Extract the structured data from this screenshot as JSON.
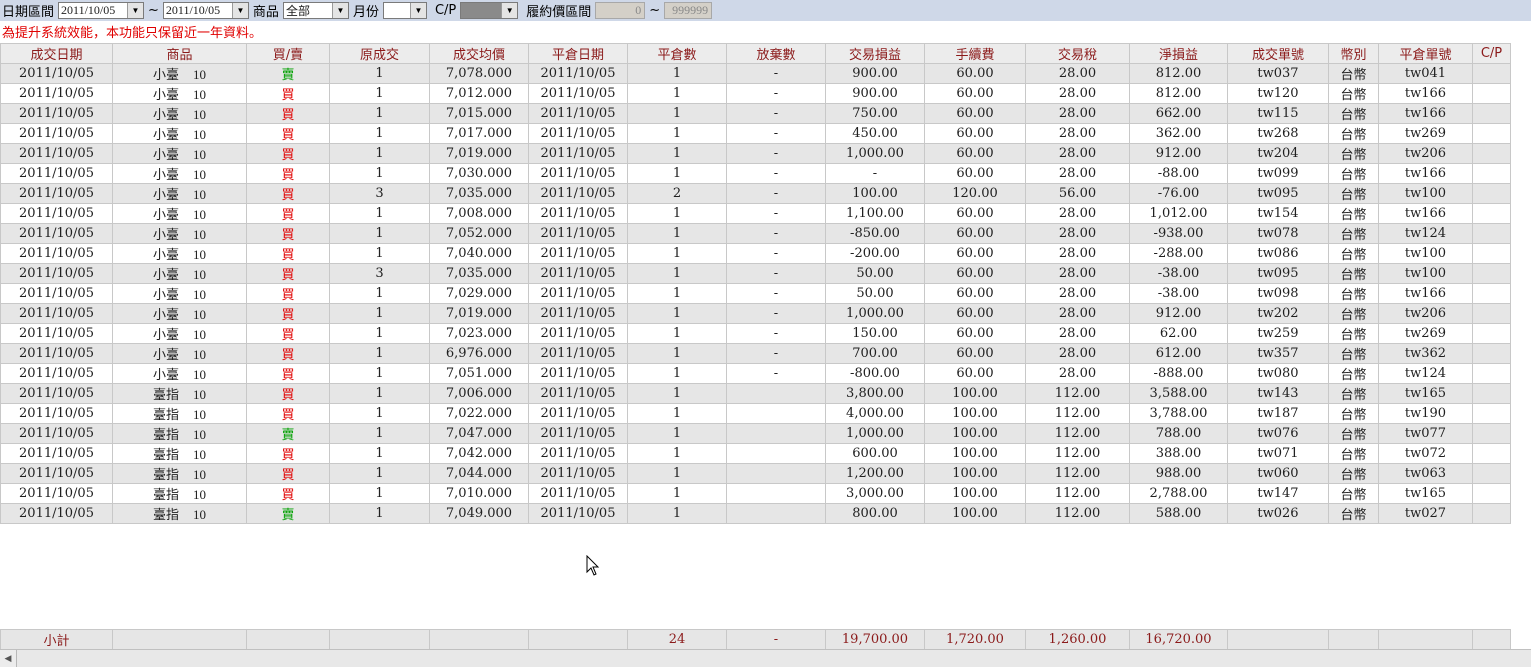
{
  "toolbar": {
    "date_range_label": "日期區間",
    "date_from": "2011/10/05",
    "date_sep": "~",
    "date_to": "2011/10/05",
    "product_label": "商品",
    "product_value": "全部",
    "month_label": "月份",
    "month_value": "",
    "cp_label": "C/P",
    "cp_value": "",
    "strike_label": "履約價區間",
    "strike_from": "0",
    "strike_sep": "~",
    "strike_to": "999999"
  },
  "notice": "為提升系統效能，本功能只保留近一年資料。",
  "columns": [
    "成交日期",
    "商品",
    "買/賣",
    "原成交",
    "成交均價",
    "平倉日期",
    "平倉數",
    "放棄數",
    "交易損益",
    "手續費",
    "交易稅",
    "淨損益",
    "成交單號",
    "幣別",
    "平倉單號",
    "C/P"
  ],
  "rows": [
    {
      "date": "2011/10/05",
      "product": "小臺",
      "code": "10",
      "side": "賣",
      "qty": "1",
      "avg": "7,078.000",
      "close_date": "2011/10/05",
      "close_qty": "1",
      "abandon": "-",
      "pl": "900.00",
      "fee": "60.00",
      "tax": "28.00",
      "net": "812.00",
      "order": "tw037",
      "cur": "台幣",
      "close_order": "tw041",
      "cp": ""
    },
    {
      "date": "2011/10/05",
      "product": "小臺",
      "code": "10",
      "side": "買",
      "qty": "1",
      "avg": "7,012.000",
      "close_date": "2011/10/05",
      "close_qty": "1",
      "abandon": "-",
      "pl": "900.00",
      "fee": "60.00",
      "tax": "28.00",
      "net": "812.00",
      "order": "tw120",
      "cur": "台幣",
      "close_order": "tw166",
      "cp": ""
    },
    {
      "date": "2011/10/05",
      "product": "小臺",
      "code": "10",
      "side": "買",
      "qty": "1",
      "avg": "7,015.000",
      "close_date": "2011/10/05",
      "close_qty": "1",
      "abandon": "-",
      "pl": "750.00",
      "fee": "60.00",
      "tax": "28.00",
      "net": "662.00",
      "order": "tw115",
      "cur": "台幣",
      "close_order": "tw166",
      "cp": ""
    },
    {
      "date": "2011/10/05",
      "product": "小臺",
      "code": "10",
      "side": "買",
      "qty": "1",
      "avg": "7,017.000",
      "close_date": "2011/10/05",
      "close_qty": "1",
      "abandon": "-",
      "pl": "450.00",
      "fee": "60.00",
      "tax": "28.00",
      "net": "362.00",
      "order": "tw268",
      "cur": "台幣",
      "close_order": "tw269",
      "cp": ""
    },
    {
      "date": "2011/10/05",
      "product": "小臺",
      "code": "10",
      "side": "買",
      "qty": "1",
      "avg": "7,019.000",
      "close_date": "2011/10/05",
      "close_qty": "1",
      "abandon": "-",
      "pl": "1,000.00",
      "fee": "60.00",
      "tax": "28.00",
      "net": "912.00",
      "order": "tw204",
      "cur": "台幣",
      "close_order": "tw206",
      "cp": ""
    },
    {
      "date": "2011/10/05",
      "product": "小臺",
      "code": "10",
      "side": "買",
      "qty": "1",
      "avg": "7,030.000",
      "close_date": "2011/10/05",
      "close_qty": "1",
      "abandon": "-",
      "pl": "-",
      "fee": "60.00",
      "tax": "28.00",
      "net": "-88.00",
      "order": "tw099",
      "cur": "台幣",
      "close_order": "tw166",
      "cp": ""
    },
    {
      "date": "2011/10/05",
      "product": "小臺",
      "code": "10",
      "side": "買",
      "qty": "3",
      "avg": "7,035.000",
      "close_date": "2011/10/05",
      "close_qty": "2",
      "abandon": "-",
      "pl": "100.00",
      "fee": "120.00",
      "tax": "56.00",
      "net": "-76.00",
      "order": "tw095",
      "cur": "台幣",
      "close_order": "tw100",
      "cp": ""
    },
    {
      "date": "2011/10/05",
      "product": "小臺",
      "code": "10",
      "side": "買",
      "qty": "1",
      "avg": "7,008.000",
      "close_date": "2011/10/05",
      "close_qty": "1",
      "abandon": "-",
      "pl": "1,100.00",
      "fee": "60.00",
      "tax": "28.00",
      "net": "1,012.00",
      "order": "tw154",
      "cur": "台幣",
      "close_order": "tw166",
      "cp": ""
    },
    {
      "date": "2011/10/05",
      "product": "小臺",
      "code": "10",
      "side": "買",
      "qty": "1",
      "avg": "7,052.000",
      "close_date": "2011/10/05",
      "close_qty": "1",
      "abandon": "-",
      "pl": "-850.00",
      "fee": "60.00",
      "tax": "28.00",
      "net": "-938.00",
      "order": "tw078",
      "cur": "台幣",
      "close_order": "tw124",
      "cp": ""
    },
    {
      "date": "2011/10/05",
      "product": "小臺",
      "code": "10",
      "side": "買",
      "qty": "1",
      "avg": "7,040.000",
      "close_date": "2011/10/05",
      "close_qty": "1",
      "abandon": "-",
      "pl": "-200.00",
      "fee": "60.00",
      "tax": "28.00",
      "net": "-288.00",
      "order": "tw086",
      "cur": "台幣",
      "close_order": "tw100",
      "cp": ""
    },
    {
      "date": "2011/10/05",
      "product": "小臺",
      "code": "10",
      "side": "買",
      "qty": "3",
      "avg": "7,035.000",
      "close_date": "2011/10/05",
      "close_qty": "1",
      "abandon": "-",
      "pl": "50.00",
      "fee": "60.00",
      "tax": "28.00",
      "net": "-38.00",
      "order": "tw095",
      "cur": "台幣",
      "close_order": "tw100",
      "cp": ""
    },
    {
      "date": "2011/10/05",
      "product": "小臺",
      "code": "10",
      "side": "買",
      "qty": "1",
      "avg": "7,029.000",
      "close_date": "2011/10/05",
      "close_qty": "1",
      "abandon": "-",
      "pl": "50.00",
      "fee": "60.00",
      "tax": "28.00",
      "net": "-38.00",
      "order": "tw098",
      "cur": "台幣",
      "close_order": "tw166",
      "cp": ""
    },
    {
      "date": "2011/10/05",
      "product": "小臺",
      "code": "10",
      "side": "買",
      "qty": "1",
      "avg": "7,019.000",
      "close_date": "2011/10/05",
      "close_qty": "1",
      "abandon": "-",
      "pl": "1,000.00",
      "fee": "60.00",
      "tax": "28.00",
      "net": "912.00",
      "order": "tw202",
      "cur": "台幣",
      "close_order": "tw206",
      "cp": ""
    },
    {
      "date": "2011/10/05",
      "product": "小臺",
      "code": "10",
      "side": "買",
      "qty": "1",
      "avg": "7,023.000",
      "close_date": "2011/10/05",
      "close_qty": "1",
      "abandon": "-",
      "pl": "150.00",
      "fee": "60.00",
      "tax": "28.00",
      "net": "62.00",
      "order": "tw259",
      "cur": "台幣",
      "close_order": "tw269",
      "cp": ""
    },
    {
      "date": "2011/10/05",
      "product": "小臺",
      "code": "10",
      "side": "買",
      "qty": "1",
      "avg": "6,976.000",
      "close_date": "2011/10/05",
      "close_qty": "1",
      "abandon": "-",
      "pl": "700.00",
      "fee": "60.00",
      "tax": "28.00",
      "net": "612.00",
      "order": "tw357",
      "cur": "台幣",
      "close_order": "tw362",
      "cp": ""
    },
    {
      "date": "2011/10/05",
      "product": "小臺",
      "code": "10",
      "side": "買",
      "qty": "1",
      "avg": "7,051.000",
      "close_date": "2011/10/05",
      "close_qty": "1",
      "abandon": "-",
      "pl": "-800.00",
      "fee": "60.00",
      "tax": "28.00",
      "net": "-888.00",
      "order": "tw080",
      "cur": "台幣",
      "close_order": "tw124",
      "cp": ""
    },
    {
      "date": "2011/10/05",
      "product": "臺指",
      "code": "10",
      "side": "買",
      "qty": "1",
      "avg": "7,006.000",
      "close_date": "2011/10/05",
      "close_qty": "1",
      "abandon": "",
      "pl": "3,800.00",
      "fee": "100.00",
      "tax": "112.00",
      "net": "3,588.00",
      "order": "tw143",
      "cur": "台幣",
      "close_order": "tw165",
      "cp": ""
    },
    {
      "date": "2011/10/05",
      "product": "臺指",
      "code": "10",
      "side": "買",
      "qty": "1",
      "avg": "7,022.000",
      "close_date": "2011/10/05",
      "close_qty": "1",
      "abandon": "",
      "pl": "4,000.00",
      "fee": "100.00",
      "tax": "112.00",
      "net": "3,788.00",
      "order": "tw187",
      "cur": "台幣",
      "close_order": "tw190",
      "cp": ""
    },
    {
      "date": "2011/10/05",
      "product": "臺指",
      "code": "10",
      "side": "賣",
      "qty": "1",
      "avg": "7,047.000",
      "close_date": "2011/10/05",
      "close_qty": "1",
      "abandon": "",
      "pl": "1,000.00",
      "fee": "100.00",
      "tax": "112.00",
      "net": "788.00",
      "order": "tw076",
      "cur": "台幣",
      "close_order": "tw077",
      "cp": ""
    },
    {
      "date": "2011/10/05",
      "product": "臺指",
      "code": "10",
      "side": "買",
      "qty": "1",
      "avg": "7,042.000",
      "close_date": "2011/10/05",
      "close_qty": "1",
      "abandon": "",
      "pl": "600.00",
      "fee": "100.00",
      "tax": "112.00",
      "net": "388.00",
      "order": "tw071",
      "cur": "台幣",
      "close_order": "tw072",
      "cp": ""
    },
    {
      "date": "2011/10/05",
      "product": "臺指",
      "code": "10",
      "side": "買",
      "qty": "1",
      "avg": "7,044.000",
      "close_date": "2011/10/05",
      "close_qty": "1",
      "abandon": "",
      "pl": "1,200.00",
      "fee": "100.00",
      "tax": "112.00",
      "net": "988.00",
      "order": "tw060",
      "cur": "台幣",
      "close_order": "tw063",
      "cp": ""
    },
    {
      "date": "2011/10/05",
      "product": "臺指",
      "code": "10",
      "side": "買",
      "qty": "1",
      "avg": "7,010.000",
      "close_date": "2011/10/05",
      "close_qty": "1",
      "abandon": "",
      "pl": "3,000.00",
      "fee": "100.00",
      "tax": "112.00",
      "net": "2,788.00",
      "order": "tw147",
      "cur": "台幣",
      "close_order": "tw165",
      "cp": ""
    },
    {
      "date": "2011/10/05",
      "product": "臺指",
      "code": "10",
      "side": "賣",
      "qty": "1",
      "avg": "7,049.000",
      "close_date": "2011/10/05",
      "close_qty": "1",
      "abandon": "",
      "pl": "800.00",
      "fee": "100.00",
      "tax": "112.00",
      "net": "588.00",
      "order": "tw026",
      "cur": "台幣",
      "close_order": "tw027",
      "cp": ""
    }
  ],
  "subtotal": {
    "label": "小計",
    "close_qty": "24",
    "abandon": "-",
    "pl": "19,700.00",
    "fee": "1,720.00",
    "tax": "1,260.00",
    "net": "16,720.00"
  },
  "colors": {
    "buy": "#e00000",
    "sell": "#00a000",
    "header_text": "#8b1a1a",
    "toolbar_bg": "#cfd8e8",
    "notice": "#e00000"
  },
  "icons": {
    "dropdown": "triangle-down",
    "scroll_left": "triangle-left",
    "cursor": "mouse-pointer"
  }
}
